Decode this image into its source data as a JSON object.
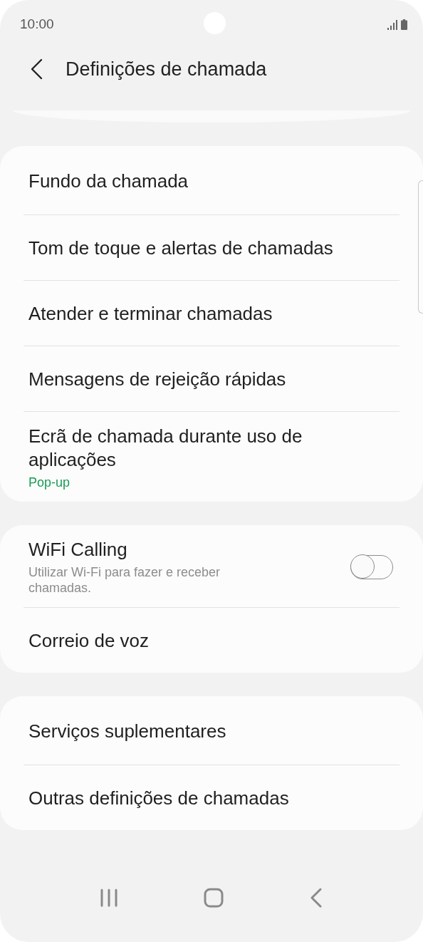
{
  "status_bar": {
    "time": "10:00"
  },
  "header": {
    "title": "Definições de chamada"
  },
  "groups": [
    {
      "items": [
        {
          "kind": "link",
          "title": "Fundo da chamada"
        },
        {
          "kind": "link",
          "title": "Tom de toque e alertas de chamadas"
        },
        {
          "kind": "link",
          "title": "Atender e terminar chamadas"
        },
        {
          "kind": "link",
          "title": "Mensagens de rejeição rápidas"
        },
        {
          "kind": "link",
          "title": "Ecrã de chamada durante uso de aplicações",
          "summary": "Pop-up"
        }
      ]
    },
    {
      "items": [
        {
          "kind": "toggle",
          "title": "WiFi Calling",
          "description": "Utilizar Wi-Fi para fazer e receber chamadas.",
          "on": false
        },
        {
          "kind": "link",
          "title": "Correio de voz"
        }
      ]
    },
    {
      "items": [
        {
          "kind": "link",
          "title": "Serviços suplementares"
        },
        {
          "kind": "link",
          "title": "Outras definições de chamadas"
        }
      ]
    }
  ]
}
